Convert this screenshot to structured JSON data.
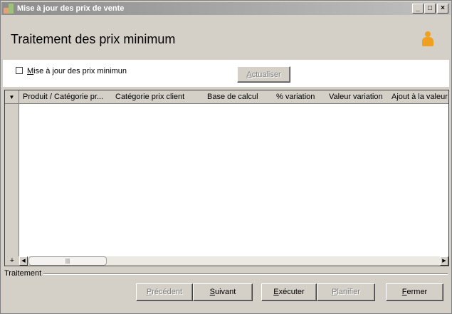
{
  "window": {
    "title": "Mise à jour des prix de vente",
    "controls": {
      "minimize": "_",
      "maximize": "□",
      "close": "×"
    }
  },
  "header": {
    "title": "Traitement des prix minimum",
    "icon": "user-icon"
  },
  "options": {
    "checkbox_label_ul": "M",
    "checkbox_label_rest": "ise à jour des prix minimun",
    "checkbox_checked": false,
    "refresh_label_ul": "A",
    "refresh_label_rest": "ctualiser"
  },
  "grid": {
    "columns": [
      "Produit / Catégorie pr...",
      "Catégorie prix client",
      "Base de calcul",
      "% variation",
      "Valeur variation",
      "Ajout à la valeur"
    ],
    "rows": [],
    "add_symbol": "+"
  },
  "footer": {
    "section_label": "Traitement",
    "buttons": {
      "prev": {
        "ul": "P",
        "rest": "récédent"
      },
      "next": {
        "ul": "S",
        "rest": "uivant"
      },
      "exec": {
        "ul": "E",
        "rest": "xécuter"
      },
      "plan": {
        "ul": "P",
        "rest": "lanifier"
      },
      "close": {
        "ul": "F",
        "rest": "ermer"
      }
    }
  }
}
